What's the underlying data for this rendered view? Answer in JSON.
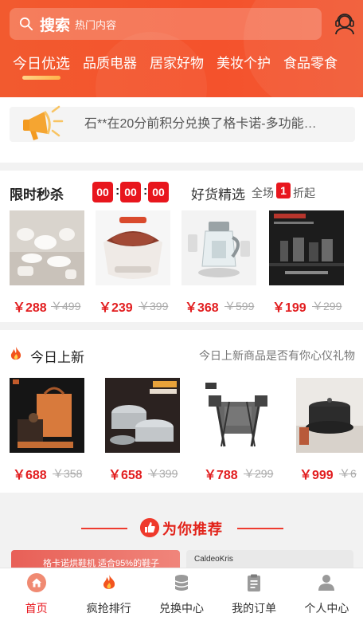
{
  "search": {
    "keyword": "搜索",
    "placeholder": "热门内容"
  },
  "tabs": [
    "今日优选",
    "品质电器",
    "居家好物",
    "美妆个护",
    "食品零食"
  ],
  "notice": {
    "text": "石**在20分前积分兑换了格卡诺-多功能…"
  },
  "flash_sale": {
    "title": "限时秒杀",
    "countdown": [
      "00",
      "00",
      "00"
    ],
    "good_title": "好货精选",
    "good_sub1": "全场",
    "good_badge": "1",
    "good_sub2": "折起",
    "products": [
      {
        "name": "ceramic-tableware-set",
        "price": "￥288",
        "old_price": "￥499"
      },
      {
        "name": "foot-bath-basin",
        "price": "￥239",
        "old_price": "￥399"
      },
      {
        "name": "health-kettle",
        "price": "￥368",
        "old_price": "￥599"
      },
      {
        "name": "kitchen-appliance-set",
        "price": "￥199",
        "old_price": "￥299"
      }
    ]
  },
  "new_arrivals": {
    "title": "今日上新",
    "subtitle": "今日上新商品是否有你心仪礼物",
    "products": [
      {
        "name": "gift-box-set",
        "price": "￥688",
        "old_price": "￥358"
      },
      {
        "name": "cookware-set",
        "price": "￥658",
        "old_price": "￥399"
      },
      {
        "name": "folding-chairs",
        "price": "￥788",
        "old_price": "￥299"
      },
      {
        "name": "pot-set",
        "price": "￥999",
        "old_price": "￥6"
      }
    ]
  },
  "recommend": {
    "title": "为你推荐",
    "card1_text": "格卡诺烘鞋机 适合95%的鞋子",
    "card2_text": "CaldeoKris"
  },
  "nav": [
    {
      "label": "首页",
      "icon": "home-icon"
    },
    {
      "label": "疯抢排行",
      "icon": "flame-icon"
    },
    {
      "label": "兑换中心",
      "icon": "coins-icon"
    },
    {
      "label": "我的订单",
      "icon": "clipboard-icon"
    },
    {
      "label": "个人中心",
      "icon": "user-icon"
    }
  ],
  "colors": {
    "primary": "#f4522c",
    "price": "#e21e20",
    "countdown": "#e8161d"
  }
}
